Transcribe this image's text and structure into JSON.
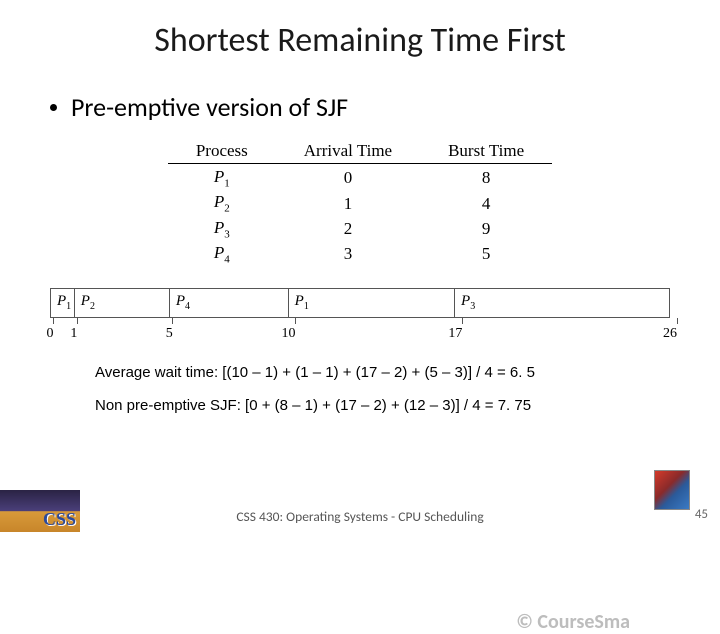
{
  "title": "Shortest Remaining Time First",
  "bullet": "Pre-emptive version of SJF",
  "table": {
    "headers": [
      "Process",
      "Arrival Time",
      "Burst Time"
    ],
    "rows": [
      {
        "p": "P",
        "sub": "1",
        "arrival": "0",
        "burst": "8"
      },
      {
        "p": "P",
        "sub": "2",
        "arrival": "1",
        "burst": "4"
      },
      {
        "p": "P",
        "sub": "3",
        "arrival": "2",
        "burst": "9"
      },
      {
        "p": "P",
        "sub": "4",
        "arrival": "3",
        "burst": "5"
      }
    ]
  },
  "gantt": {
    "total": 26,
    "segments": [
      {
        "p": "P",
        "sub": "1",
        "start": 0,
        "end": 1
      },
      {
        "p": "P",
        "sub": "2",
        "start": 1,
        "end": 5
      },
      {
        "p": "P",
        "sub": "4",
        "start": 5,
        "end": 10
      },
      {
        "p": "P",
        "sub": "1",
        "start": 10,
        "end": 17
      },
      {
        "p": "P",
        "sub": "3",
        "start": 17,
        "end": 26
      }
    ],
    "ticks": [
      "0",
      "1",
      "5",
      "10",
      "17",
      "26"
    ]
  },
  "watermark": "© CourseSma",
  "calc1": "Average wait time: [(10 – 1) + (1 – 1) + (17 – 2) + (5 – 3)] / 4 = 6. 5",
  "calc2": "Non pre-emptive SJF: [0 + (8 – 1) + (17 – 2) + (12 – 3)] / 4 = 7. 75",
  "footer": "CSS 430: Operating Systems - CPU Scheduling",
  "page": "45",
  "logo_left": "CSS"
}
